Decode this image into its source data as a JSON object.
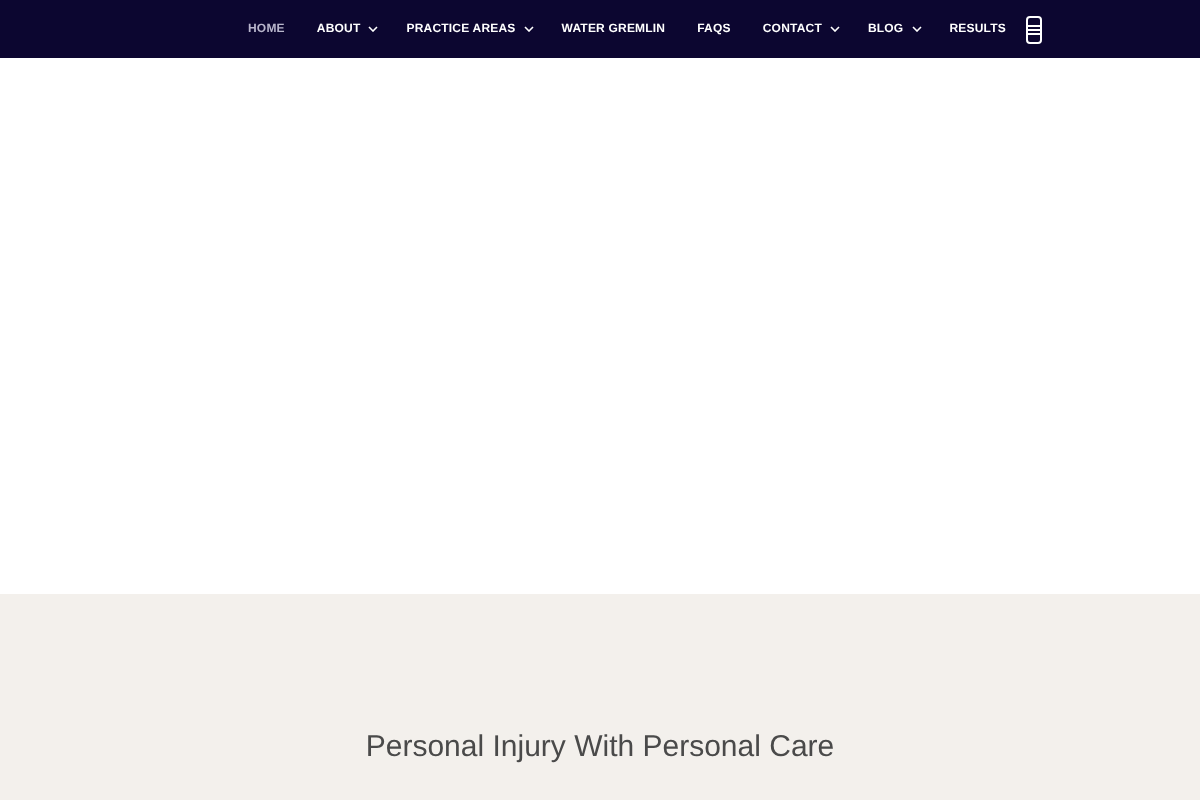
{
  "nav": {
    "items": [
      {
        "label": "HOME",
        "selected": true,
        "dropdown": false
      },
      {
        "label": "ABOUT",
        "selected": false,
        "dropdown": true
      },
      {
        "label": "PRACTICE AREAS",
        "selected": false,
        "dropdown": true
      },
      {
        "label": "WATER GREMLIN",
        "selected": false,
        "dropdown": false
      },
      {
        "label": "FAQS",
        "selected": false,
        "dropdown": false
      },
      {
        "label": "CONTACT",
        "selected": false,
        "dropdown": true
      },
      {
        "label": "BLOG",
        "selected": false,
        "dropdown": true
      },
      {
        "label": "RESULTS",
        "selected": false,
        "dropdown": false
      }
    ]
  },
  "intro": {
    "heading": "Personal Injury With Personal Care"
  }
}
